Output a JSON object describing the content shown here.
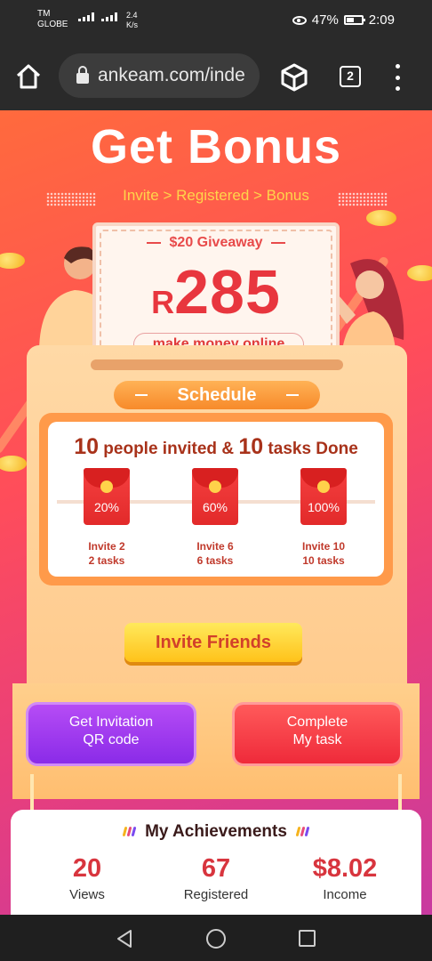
{
  "status_bar": {
    "carrier_line1": "TM",
    "carrier_line2": "GLOBE",
    "network_speed_value": "2.4",
    "network_speed_unit": "K/s",
    "network_type": "4G",
    "battery": "47%",
    "time": "2:09"
  },
  "browser": {
    "url": "ankeam.com/inde",
    "tab_count": "2"
  },
  "page": {
    "title": "Get Bonus",
    "steps": "Invite >  Registered >  Bonus",
    "ticket": {
      "giveaway": "$20 Giveaway",
      "currency": "R",
      "amount": "285",
      "tagline": "make money online"
    },
    "schedule_label": "Schedule",
    "progress": {
      "invited_count": "10",
      "invited_text": " people invited & ",
      "tasks_count": "10",
      "tasks_text": " tasks Done",
      "milestones": [
        {
          "percent": "20%",
          "invite": "Invite 2",
          "tasks": "2 tasks"
        },
        {
          "percent": "60%",
          "invite": "Invite 6",
          "tasks": "6 tasks"
        },
        {
          "percent": "100%",
          "invite": "Invite 10",
          "tasks": "10 tasks"
        }
      ]
    },
    "invite_button": "Invite Friends",
    "qr_button": {
      "line1": "Get Invitation",
      "line2": "QR code"
    },
    "task_button": {
      "line1": "Complete",
      "line2": "My task"
    },
    "achievements": {
      "title": "My Achievements",
      "stats": [
        {
          "value": "20",
          "label": "Views"
        },
        {
          "value": "67",
          "label": "Registered"
        },
        {
          "value": "$8.02",
          "label": "Income"
        }
      ]
    }
  },
  "colors": {
    "accent_red": "#e8363e",
    "gold": "#ffd54a",
    "purple": "#8a2be8"
  }
}
